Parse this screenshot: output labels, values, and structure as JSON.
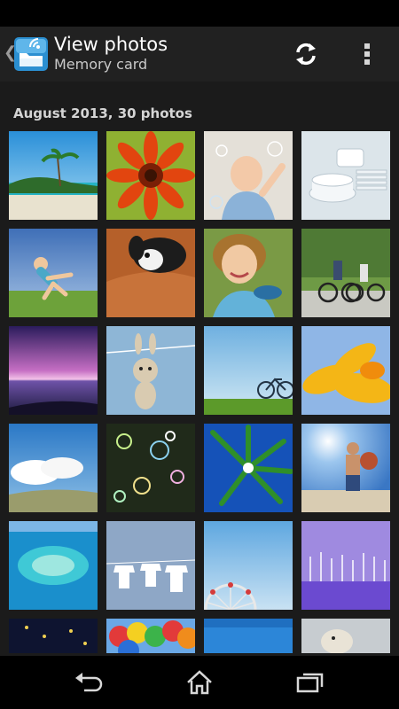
{
  "action_bar": {
    "title": "View photos",
    "subtitle": "Memory card",
    "back_icon": "chevron-left-icon",
    "app_icon": "wifi-folder-icon",
    "sync_icon": "sync-icon",
    "menu_icon": "overflow-menu-icon"
  },
  "section": {
    "header": "August 2013, 30 photos"
  },
  "photos": [
    {
      "subject": "tropical beach with palm trees"
    },
    {
      "subject": "orange gerbera daisy"
    },
    {
      "subject": "baby with soap bubbles"
    },
    {
      "subject": "stacked white dishes"
    },
    {
      "subject": "child jumping on grass"
    },
    {
      "subject": "puppy on leather sofa"
    },
    {
      "subject": "smiling girl holding bowl"
    },
    {
      "subject": "family riding bicycles"
    },
    {
      "subject": "purple sunset over sea"
    },
    {
      "subject": "toy bunny on clothesline"
    },
    {
      "subject": "bicycle on green field"
    },
    {
      "subject": "yellow flower petals"
    },
    {
      "subject": "clouds over meadow"
    },
    {
      "subject": "colorful bubbles bokeh"
    },
    {
      "subject": "palm leaves against blue sky"
    },
    {
      "subject": "man holding ball on beach"
    },
    {
      "subject": "aerial view of reef island"
    },
    {
      "subject": "t-shirts on clothesline"
    },
    {
      "subject": "ferris wheel under sky"
    },
    {
      "subject": "purple trees winter landscape"
    },
    {
      "subject": "night lights"
    },
    {
      "subject": "colorful balloons"
    },
    {
      "subject": "blue sky"
    },
    {
      "subject": "puppy close up"
    }
  ],
  "nav_bar": {
    "back_icon": "back-arrow-icon",
    "home_icon": "home-icon",
    "recents_icon": "recent-apps-icon"
  }
}
